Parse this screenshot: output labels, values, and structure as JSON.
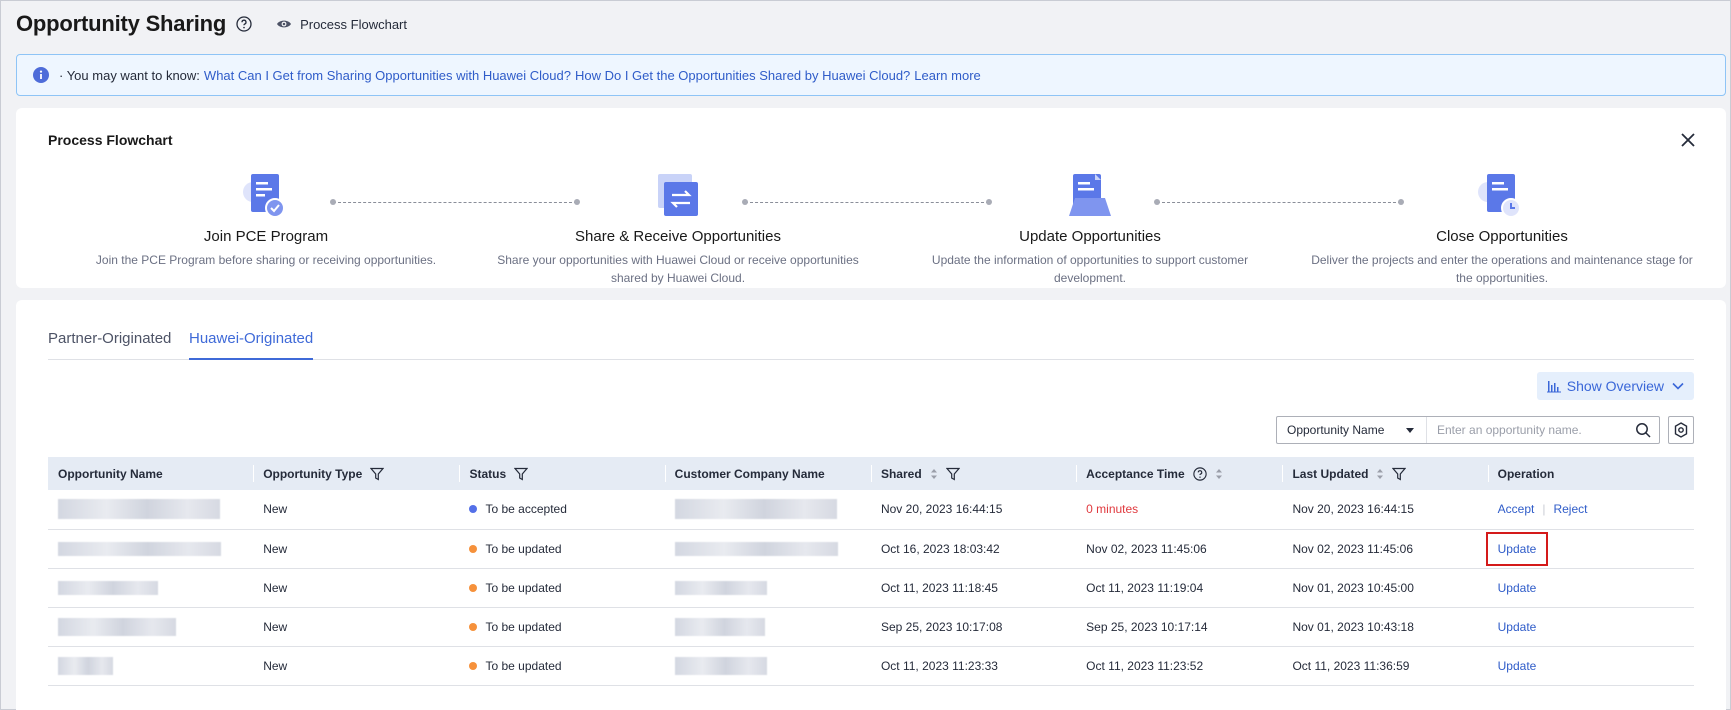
{
  "header": {
    "title": "Opportunity Sharing",
    "flowchart_link": "Process Flowchart"
  },
  "notice": {
    "lead": "· You may want to know:",
    "links": [
      "What Can I Get from Sharing Opportunities with Huawei Cloud?",
      "How Do I Get the Opportunities Shared by Huawei Cloud?",
      "Learn more"
    ]
  },
  "flowchart": {
    "title": "Process Flowchart",
    "steps": [
      {
        "title": "Join PCE Program",
        "desc": "Join the PCE Program before sharing or receiving opportunities."
      },
      {
        "title": "Share & Receive Opportunities",
        "desc": "Share your opportunities with Huawei Cloud or receive opportunities shared by Huawei Cloud."
      },
      {
        "title": "Update Opportunities",
        "desc": "Update the information of opportunities to support customer development."
      },
      {
        "title": "Close Opportunities",
        "desc": "Deliver the projects and enter the operations and maintenance stage for the opportunities."
      }
    ]
  },
  "tabs": [
    {
      "label": "Partner-Originated",
      "active": false
    },
    {
      "label": "Huawei-Originated",
      "active": true
    }
  ],
  "toolbar": {
    "overview_label": "Show Overview",
    "search_field": "Opportunity Name",
    "search_placeholder": "Enter an opportunity name."
  },
  "table": {
    "columns": [
      "Opportunity Name",
      "Opportunity Type",
      "Status",
      "Customer Company Name",
      "Shared",
      "Acceptance Time",
      "Last Updated",
      "Operation"
    ],
    "rows": [
      {
        "type": "New",
        "status": "To be accepted",
        "status_color": "#5470e8",
        "shared": "Nov 20, 2023 16:44:15",
        "acceptance": "0 minutes",
        "updated": "Nov 20, 2023 16:44:15",
        "ops": [
          "Accept",
          "Reject"
        ]
      },
      {
        "type": "New",
        "status": "To be updated",
        "status_color": "#f6913b",
        "shared": "Oct 16, 2023 18:03:42",
        "acceptance": "Nov 02, 2023 11:45:06",
        "updated": "Nov 02, 2023 11:45:06",
        "ops": [
          "Update"
        ]
      },
      {
        "type": "New",
        "status": "To be updated",
        "status_color": "#f6913b",
        "shared": "Oct 11, 2023 11:18:45",
        "acceptance": "Oct 11, 2023 11:19:04",
        "updated": "Nov 01, 2023 10:45:00",
        "ops": [
          "Update"
        ]
      },
      {
        "type": "New",
        "status": "To be updated",
        "status_color": "#f6913b",
        "shared": "Sep 25, 2023 10:17:08",
        "acceptance": "Sep 25, 2023 10:17:14",
        "updated": "Nov 01, 2023 10:43:18",
        "ops": [
          "Update"
        ]
      },
      {
        "type": "New",
        "status": "To be updated",
        "status_color": "#f6913b",
        "shared": "Oct 11, 2023 11:23:33",
        "acceptance": "Oct 11, 2023 11:23:52",
        "updated": "Oct 11, 2023 11:36:59",
        "ops": [
          "Update"
        ]
      }
    ]
  }
}
